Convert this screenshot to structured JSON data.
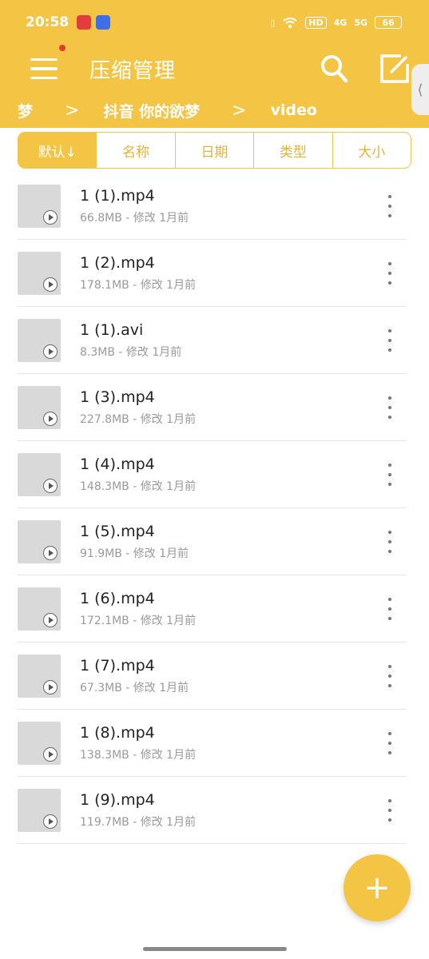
{
  "status_bar": {
    "time": "20:58",
    "hd": "HD",
    "net1": "4G",
    "net2": "5G",
    "battery": "66"
  },
  "app_bar": {
    "title": "压缩管理"
  },
  "breadcrumb": [
    "梦",
    "抖音  你的欲梦",
    "video"
  ],
  "sort_tabs": [
    "默认↓",
    "名称",
    "日期",
    "类型",
    "大小"
  ],
  "files": [
    {
      "name": "1 (1).mp4",
      "meta": "66.8MB - 修改 1月前"
    },
    {
      "name": "1 (2).mp4",
      "meta": "178.1MB - 修改 1月前"
    },
    {
      "name": "1 (1).avi",
      "meta": "8.3MB - 修改 1月前"
    },
    {
      "name": "1 (3).mp4",
      "meta": "227.8MB - 修改 1月前"
    },
    {
      "name": "1 (4).mp4",
      "meta": "148.3MB - 修改 1月前"
    },
    {
      "name": "1 (5).mp4",
      "meta": "91.9MB - 修改 1月前"
    },
    {
      "name": "1 (6).mp4",
      "meta": "172.1MB - 修改 1月前"
    },
    {
      "name": "1 (7).mp4",
      "meta": "67.3MB - 修改 1月前"
    },
    {
      "name": "1 (8).mp4",
      "meta": "138.3MB - 修改 1月前"
    },
    {
      "name": "1 (9).mp4",
      "meta": "119.7MB - 修改 1月前"
    }
  ],
  "icons": {
    "menu": "menu-icon",
    "search": "search-icon",
    "edit": "edit-icon",
    "chevron": "chevron-right-icon",
    "play": "play-icon",
    "more": "more-vertical-icon",
    "add": "plus-icon"
  },
  "colors": {
    "accent": "#f4c544",
    "list_text": "#222222",
    "meta_text": "#9a9a9a"
  }
}
